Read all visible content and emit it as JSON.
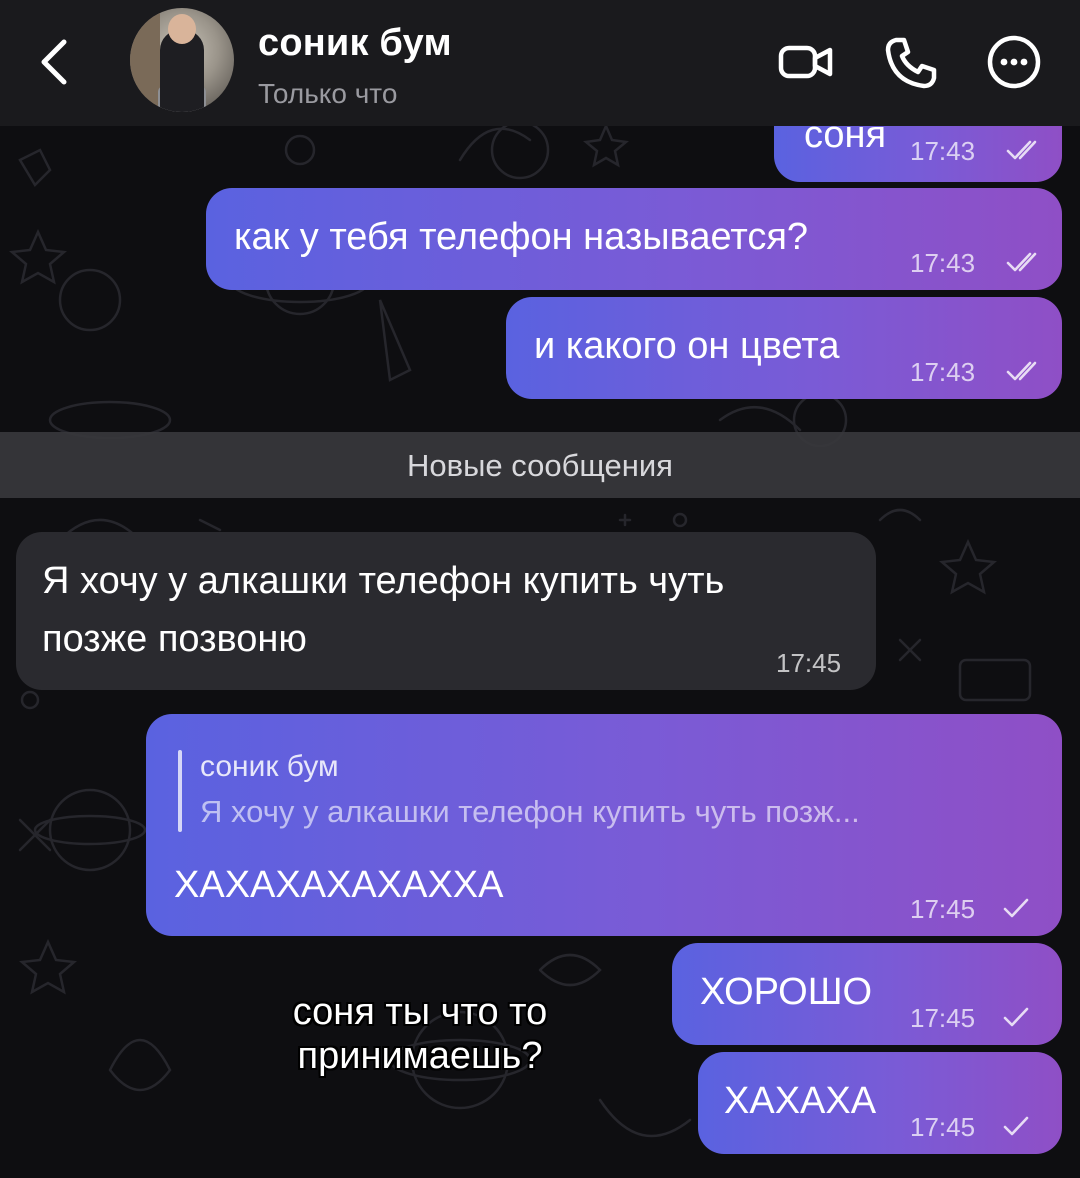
{
  "header": {
    "contact_name": "соник бум",
    "status": "Только что"
  },
  "icons": {
    "back": "chevron-left-icon",
    "video": "video-camera-icon",
    "call": "phone-icon",
    "more": "more-dots-icon"
  },
  "messages": [
    {
      "id": "m0",
      "direction": "out",
      "text": "соня",
      "time": "17:43",
      "status": "read"
    },
    {
      "id": "m1",
      "direction": "out",
      "text": "как у тебя телефон называется?",
      "time": "17:43",
      "status": "read"
    },
    {
      "id": "m2",
      "direction": "out",
      "text": "и какого он цвета",
      "time": "17:43",
      "status": "read"
    },
    {
      "id": "m3",
      "direction": "in",
      "text_line1": "Я хочу у алкашки телефон купить чуть",
      "text_line2": "позже позвоню",
      "time": "17:45"
    },
    {
      "id": "m4",
      "direction": "out",
      "reply_name": "соник бум",
      "reply_text": "Я хочу у алкашки телефон купить чуть позж...",
      "text": "ХАХАХАХАХАХХА",
      "time": "17:45",
      "status": "sent"
    },
    {
      "id": "m5",
      "direction": "out",
      "text": "ХОРОШО",
      "time": "17:45",
      "status": "sent"
    },
    {
      "id": "m6",
      "direction": "out",
      "text": "ХАХАХА",
      "time": "17:45",
      "status": "sent"
    }
  ],
  "divider": "Новые сообщения",
  "caption": {
    "line1": "соня ты что то",
    "line2": "принимаешь?"
  },
  "colors": {
    "header_bg": "#1a1a1d",
    "outgoing_start": "#5a62e0",
    "outgoing_end": "#8f4fc6",
    "incoming": "#2a2a2f"
  }
}
